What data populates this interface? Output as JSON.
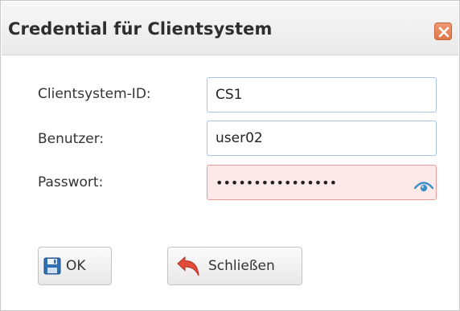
{
  "dialog": {
    "title": "Credential für Clientsystem",
    "close_icon": "close-icon"
  },
  "form": {
    "clientsystem_id_label": "Clientsystem-ID:",
    "clientsystem_id_value": "CS1",
    "user_label": "Benutzer:",
    "user_value": "user02",
    "password_label": "Passwort:",
    "password_value": "••••••••••••••••",
    "password_toggle_icon": "eye-icon"
  },
  "buttons": {
    "ok_label": "OK",
    "ok_icon": "floppy-disk-icon",
    "close_label": "Schließen",
    "close_icon": "undo-arrow-icon"
  },
  "colors": {
    "password_field_bg": "#fde9e8",
    "password_field_border": "#ec9a96",
    "input_border": "#a9c3e2",
    "close_button": "#e0764c",
    "eye_icon": "#3a8fc6"
  }
}
